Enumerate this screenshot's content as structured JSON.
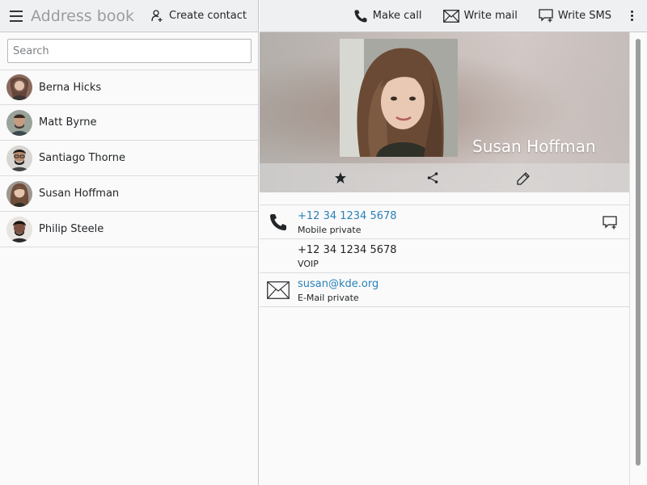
{
  "header": {
    "app_title": "Address book",
    "create_contact_label": "Create contact"
  },
  "search": {
    "placeholder": "Search",
    "value": ""
  },
  "contacts": [
    {
      "name": "Berna Hicks"
    },
    {
      "name": "Matt Byrne"
    },
    {
      "name": "Santiago Thorne"
    },
    {
      "name": "Susan Hoffman"
    },
    {
      "name": "Philip Steele"
    }
  ],
  "toolbar": {
    "make_call_label": "Make call",
    "write_mail_label": "Write mail",
    "write_sms_label": "Write SMS"
  },
  "detail": {
    "name": "Susan Hoffman",
    "entries": [
      {
        "value": "+12 34 1234 5678",
        "label": "Mobile private",
        "icon": "phone-icon",
        "action_icon": "sms-icon"
      },
      {
        "value": "+12 34 1234 5678",
        "label": "VOIP"
      },
      {
        "value": "susan@kde.org",
        "label": "E-Mail private",
        "icon": "mail-icon"
      }
    ]
  },
  "colors": {
    "accent_link": "#2980b9",
    "header_bg": "#eff0f1",
    "app_title": "#9a9c9e"
  }
}
